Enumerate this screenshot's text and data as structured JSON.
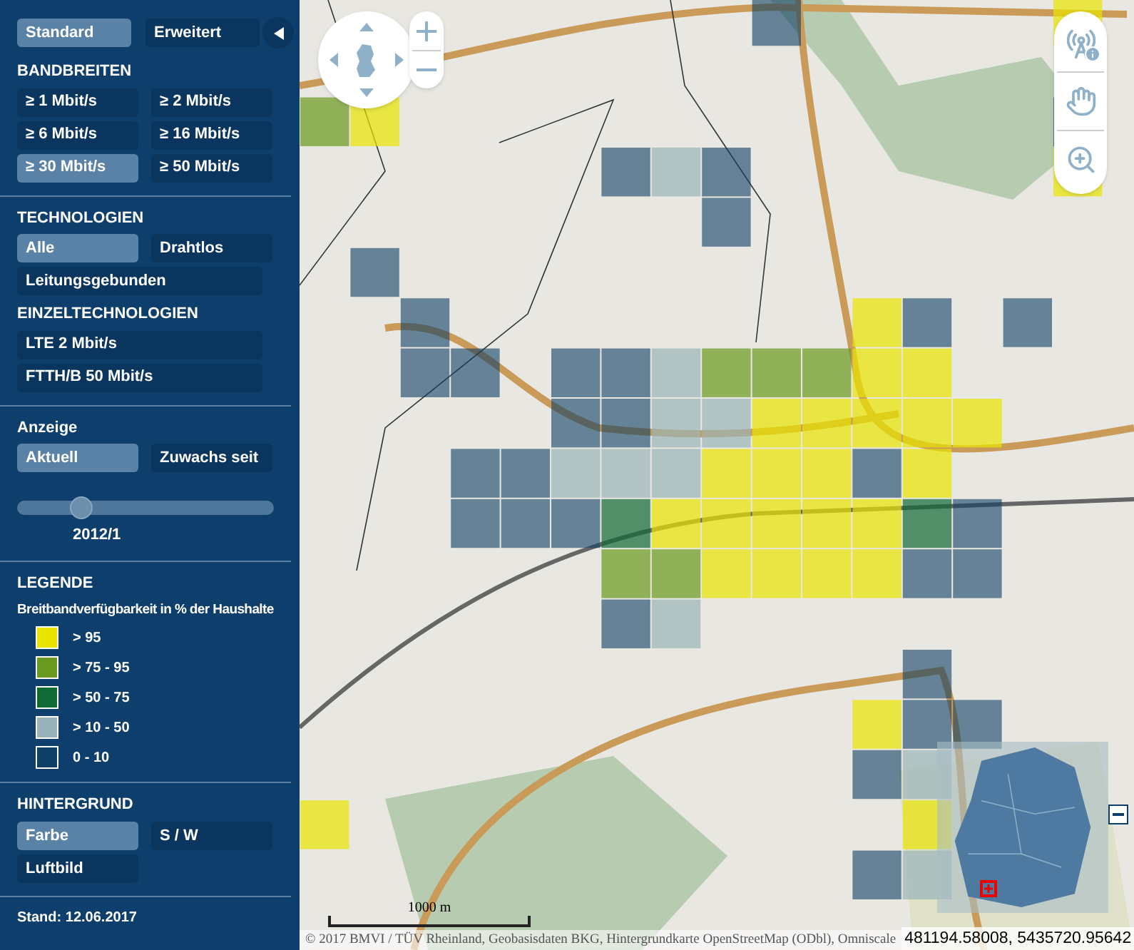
{
  "view_tabs": [
    {
      "label": "Standard",
      "selected": true
    },
    {
      "label": "Erweitert",
      "selected": false
    }
  ],
  "bandbreiten": {
    "title": "BANDBREITEN",
    "options": [
      {
        "label": "≥ 1 Mbit/s",
        "selected": false
      },
      {
        "label": "≥ 2 Mbit/s",
        "selected": false
      },
      {
        "label": "≥ 6 Mbit/s",
        "selected": false
      },
      {
        "label": "≥ 16 Mbit/s",
        "selected": false
      },
      {
        "label": "≥ 30 Mbit/s",
        "selected": true
      },
      {
        "label": "≥ 50 Mbit/s",
        "selected": false
      }
    ]
  },
  "technologien": {
    "title": "TECHNOLOGIEN",
    "options": [
      {
        "label": "Alle",
        "selected": true
      },
      {
        "label": "Drahtlos",
        "selected": false
      },
      {
        "label": "Leitungsgebunden",
        "selected": false
      }
    ]
  },
  "einzeltechnologien": {
    "title": "EINZELTECHNOLOGIEN",
    "options": [
      {
        "label": "LTE 2 Mbit/s",
        "selected": false
      },
      {
        "label": "FTTH/B 50 Mbit/s",
        "selected": false
      }
    ]
  },
  "anzeige": {
    "title": "Anzeige",
    "options": [
      {
        "label": "Aktuell",
        "selected": true
      },
      {
        "label": "Zuwachs seit",
        "selected": false
      }
    ],
    "slider": {
      "level": 0.25,
      "reading": "2012/1"
    }
  },
  "legende": {
    "title": "LEGENDE",
    "subtitle": "Breitbandverfügbarkeit in % der Haushalte",
    "items": [
      {
        "label": "> 95",
        "color": "#e8e400"
      },
      {
        "label": "> 75 - 95",
        "color": "#6a9a1e"
      },
      {
        "label": "> 50 - 75",
        "color": "#0f6a35"
      },
      {
        "label": "> 10 - 50",
        "color": "#9ab3b8"
      },
      {
        "label": "0 - 10",
        "color": "#0f3f66"
      }
    ]
  },
  "hintergrund": {
    "title": "HINTERGRUND",
    "options": [
      {
        "label": "Farbe",
        "selected": true
      },
      {
        "label": "S / W",
        "selected": false
      },
      {
        "label": "Luftbild",
        "selected": false
      }
    ]
  },
  "stand": "Stand: 12.06.2017",
  "map": {
    "scale_label": "1000 m",
    "attribution": "© 2017 BMVI / TÜV Rheinland, Geobasisdaten BKG, Hintergrundkarte OpenStreetMap (ODbl), Omniscale",
    "coordinates": "481194.58008, 5435720.95642"
  }
}
